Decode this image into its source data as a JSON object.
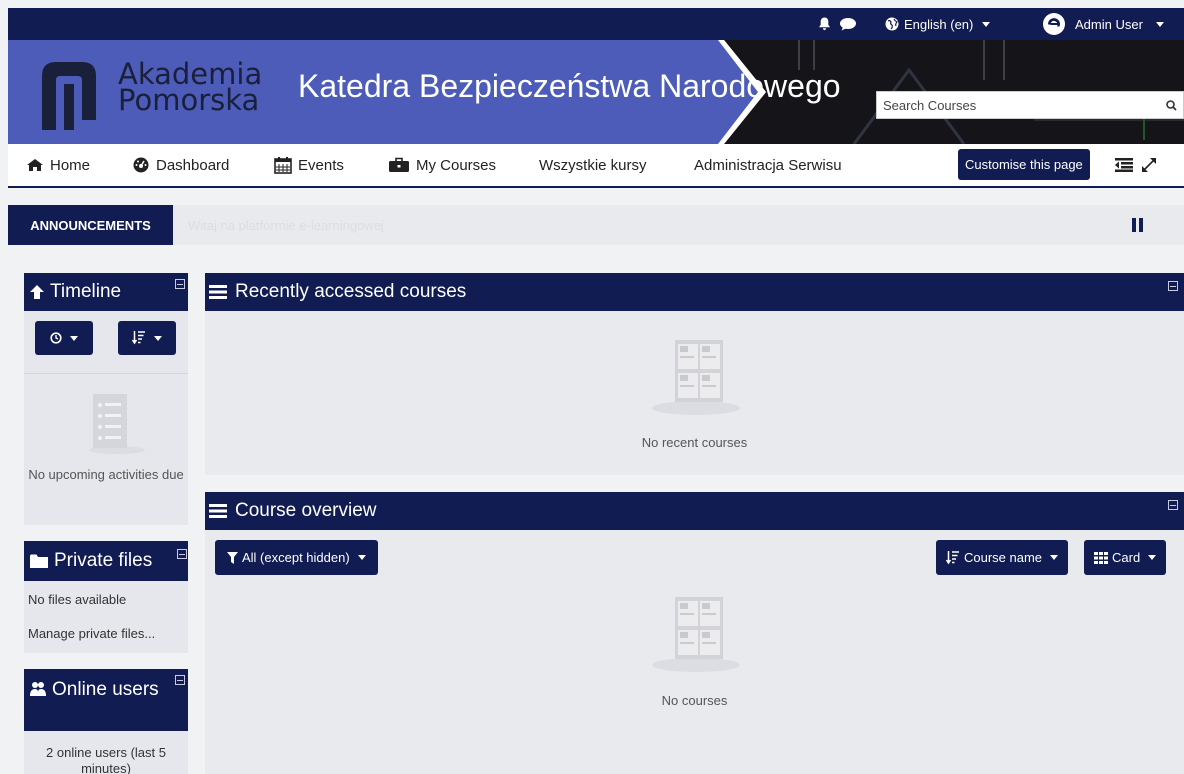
{
  "topbar": {
    "notification_icon": "bell-icon",
    "message_icon": "message-icon",
    "language": "English (en)",
    "user_name": "Admin User"
  },
  "banner": {
    "brand_line1": "Akademia",
    "brand_line2": "Pomorska",
    "site_title": "Katedra Bezpieczeństwa Narodowego",
    "search_placeholder": "Search Courses"
  },
  "nav": {
    "items": [
      {
        "label": "Home",
        "icon": "home-icon"
      },
      {
        "label": "Dashboard",
        "icon": "dashboard-icon"
      },
      {
        "label": "Events",
        "icon": "calendar-icon"
      },
      {
        "label": "My Courses",
        "icon": "briefcase-icon"
      },
      {
        "label": "Wszystkie kursy"
      },
      {
        "label": "Administracja Serwisu"
      }
    ],
    "customise_label": "Customise this page"
  },
  "announcements": {
    "label": "ANNOUNCEMENTS",
    "text": "Witaj na platformie e-learningowej"
  },
  "timeline": {
    "title": "Timeline",
    "empty_text": "No upcoming activities due"
  },
  "private_files": {
    "title": "Private files",
    "no_files": "No files available",
    "manage_link": "Manage private files..."
  },
  "online_users": {
    "title": "Online users",
    "summary": "2 online users (last 5 minutes)"
  },
  "recent_courses": {
    "title": "Recently accessed courses",
    "empty_text": "No recent courses"
  },
  "course_overview": {
    "title": "Course overview",
    "filter_label": "All (except hidden)",
    "sort_label": "Course name",
    "view_label": "Card",
    "empty_text": "No courses"
  },
  "colors": {
    "navy": "#101c52",
    "banner_blue": "#4d5cb8",
    "panel_bg": "#e9eaee"
  }
}
